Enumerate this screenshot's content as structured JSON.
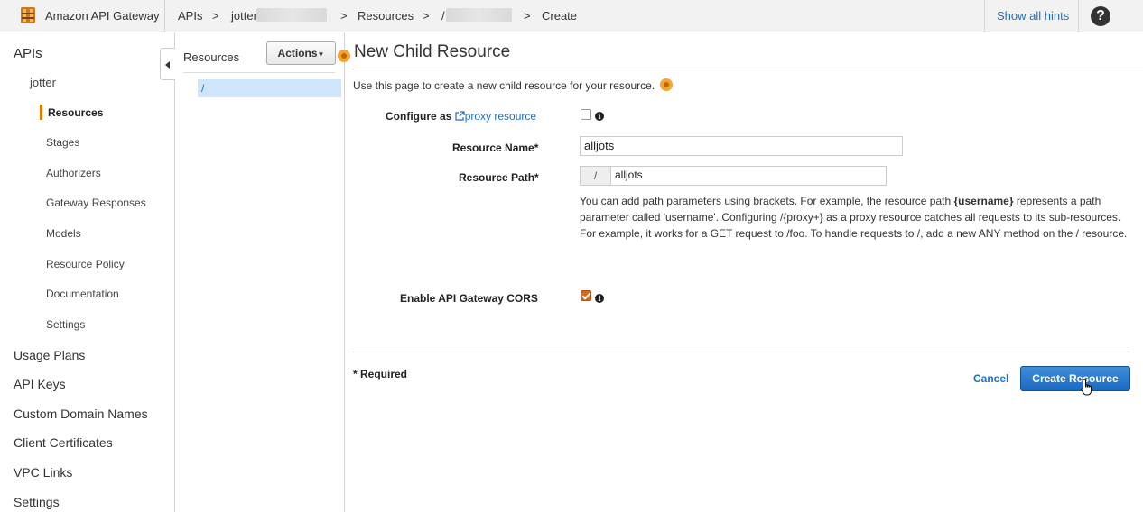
{
  "header": {
    "app_title": "Amazon API Gateway",
    "breadcrumbs": [
      "APIs",
      "jotter",
      "Resources",
      "/",
      "Create"
    ],
    "separator": ">",
    "show_hints": "Show all hints",
    "help": "?"
  },
  "sidebar": {
    "top_item": "APIs",
    "api_name": "jotter",
    "api_items": [
      "Resources",
      "Stages",
      "Authorizers",
      "Gateway Responses",
      "Models",
      "Resource Policy",
      "Documentation",
      "Settings"
    ],
    "active_item": "Resources",
    "bottom_items": [
      "Usage Plans",
      "API Keys",
      "Custom Domain Names",
      "Client Certificates",
      "VPC Links",
      "Settings"
    ]
  },
  "resources_panel": {
    "title": "Resources",
    "actions_label": "Actions",
    "selected_path": "/"
  },
  "form": {
    "title": "New Child Resource",
    "intro": "Use this page to create a new child resource for your resource.",
    "configure_as_label": "Configure as",
    "proxy_link": "proxy resource",
    "proxy_checked": false,
    "resource_name_label": "Resource Name*",
    "resource_name_value": "alljots",
    "resource_path_label": "Resource Path*",
    "path_prefix": "/",
    "resource_path_value": "alljots",
    "help_text_1": "You can add path parameters using brackets. For example, the resource path ",
    "help_text_bold": "{username}",
    "help_text_2": " represents a path parameter called 'username'. Configuring /{proxy+} as a proxy resource catches all requests to its sub-resources. For example, it works for a GET request to /foo. To handle requests to /, add a new ANY method on the / resource.",
    "cors_label": "Enable API Gateway CORS",
    "cors_checked": true,
    "required_note": "* Required",
    "cancel_label": "Cancel",
    "create_label": "Create Resource"
  },
  "colors": {
    "accent_orange": "#e07b00",
    "link_blue": "#1f6fc0",
    "button_blue": "#1c69c0",
    "selected_bg": "#cfe5fb"
  }
}
